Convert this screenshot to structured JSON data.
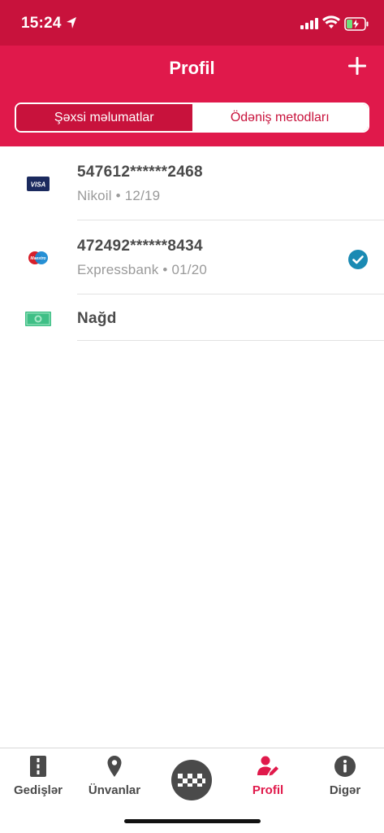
{
  "status": {
    "time": "15:24"
  },
  "nav": {
    "title": "Profil"
  },
  "segments": [
    {
      "label": "Şəxsi məlumatlar"
    },
    {
      "label": "Ödəniş metodları"
    }
  ],
  "payment_methods": [
    {
      "icon": "visa-card-icon",
      "title": "547612******2468",
      "subtitle": "Nikoil • 12/19",
      "selected": false
    },
    {
      "icon": "maestro-card-icon",
      "title": "472492******8434",
      "subtitle": "Expressbank • 01/20",
      "selected": true
    },
    {
      "icon": "cash-icon",
      "title": "Nağd",
      "subtitle": "",
      "selected": false
    }
  ],
  "card_logos": {
    "visa": "VISA",
    "maestro": "Maestro"
  },
  "tabs": [
    {
      "label": "Gedişlər",
      "icon": "road-icon"
    },
    {
      "label": "Ünvanlar",
      "icon": "map-pin-icon"
    },
    {
      "label": "",
      "icon": "taxi-icon"
    },
    {
      "label": "Profil",
      "icon": "user-edit-icon"
    },
    {
      "label": "Digər",
      "icon": "info-icon"
    }
  ],
  "colors": {
    "primary": "#e0194b",
    "status_bar": "#c8123c",
    "check": "#1a8ab3",
    "text": "#4a4a4a",
    "subtext": "#9a9a9a"
  }
}
